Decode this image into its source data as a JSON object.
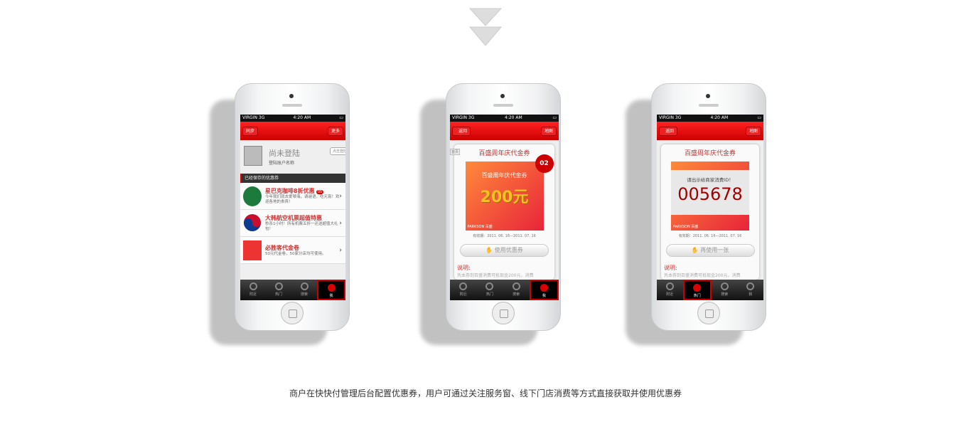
{
  "caption": "商户在快快付管理后台配置优惠券，用户可通过关注服务窗、线下门店消费等方式直接获取并使用优惠券",
  "status": {
    "carrier": "VIRGIN",
    "network": "3G",
    "time": "4:20 AM"
  },
  "tabs": [
    "附近",
    "热门",
    "搜索",
    "我"
  ],
  "phone1": {
    "left_btn": "同步",
    "right_btn": "更多",
    "user_name": "尚未登陆",
    "user_sub": "登陆账户名称",
    "login_hint": "点击登陆",
    "section": "已经保存的优惠券",
    "items": [
      {
        "title": "星巴克咖啡8折优惠",
        "badge": "05",
        "desc": "今年我们就去爱琴海，请谜语，吃元宵！欢迎各地的贵宾！"
      },
      {
        "title": "大韩航空机票超值特惠",
        "desc": "秒杀1小时！所有机票五折一还送超值大礼包！"
      },
      {
        "title": "必胜客代金卷",
        "desc": "50元代金卷，50家分店均可使用。"
      }
    ]
  },
  "phone2": {
    "left_btn": "返回",
    "right_btn": "地图",
    "side_tag": "首页",
    "title": "百盛周年庆代金券",
    "coupon_title": "百盛周年庆代金券",
    "amount": "200元",
    "count": "02",
    "brand": "PARKSON 百盛",
    "valid": "有效期：2011. 06. 16—2011. 07. 16",
    "button": "使用优惠券",
    "desc_label": "说明:",
    "desc": "凭本券到百盛消费可抵现金200元，消费"
  },
  "phone3": {
    "left_btn": "返回",
    "right_btn": "地图",
    "title": "百盛周年庆代金券",
    "prompt": "请出示给商家消费ID！",
    "code": "005678",
    "brand": "PARKSON 百盛",
    "valid": "有效期：2011. 06. 16—2011. 07. 16",
    "button": "再使用一张",
    "desc_label": "说明:",
    "desc": "凭本券到百盛消费可抵现金200元，消费"
  },
  "colors": {
    "accent": "#dd1111",
    "title_red": "#b33333",
    "code_red": "#a00000"
  }
}
